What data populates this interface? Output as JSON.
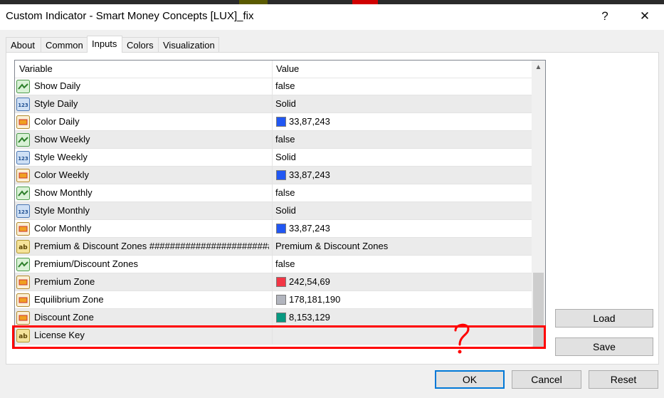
{
  "window": {
    "title": "Custom Indicator - Smart Money Concepts [LUX]_fix",
    "help_label": "?",
    "close_label": "✕"
  },
  "tabs": [
    {
      "label": "About"
    },
    {
      "label": "Common"
    },
    {
      "label": "Inputs",
      "active": true
    },
    {
      "label": "Colors"
    },
    {
      "label": "Visualization"
    }
  ],
  "grid": {
    "col_variable": "Variable",
    "col_value": "Value",
    "scroll_up_glyph": "▲",
    "rows": [
      {
        "icon": "bool-icon",
        "name": "Show Daily",
        "value": "false"
      },
      {
        "icon": "int-icon",
        "name": "Style Daily",
        "value": "Solid"
      },
      {
        "icon": "color-icon",
        "name": "Color Daily",
        "value": "33,87,243",
        "swatch": "#2157f3"
      },
      {
        "icon": "bool-icon",
        "name": "Show Weekly",
        "value": "false"
      },
      {
        "icon": "int-icon",
        "name": "Style Weekly",
        "value": "Solid"
      },
      {
        "icon": "color-icon",
        "name": "Color Weekly",
        "value": "33,87,243",
        "swatch": "#2157f3"
      },
      {
        "icon": "bool-icon",
        "name": "Show Monthly",
        "value": "false"
      },
      {
        "icon": "int-icon",
        "name": "Style Monthly",
        "value": "Solid"
      },
      {
        "icon": "color-icon",
        "name": "Color Monthly",
        "value": "33,87,243",
        "swatch": "#2157f3"
      },
      {
        "icon": "string-icon",
        "name": "Premium & Discount Zones #####################################",
        "value": "Premium & Discount Zones"
      },
      {
        "icon": "bool-icon",
        "name": "Premium/Discount Zones",
        "value": "false"
      },
      {
        "icon": "color-icon",
        "name": "Premium Zone",
        "value": "242,54,69",
        "swatch": "#f23645"
      },
      {
        "icon": "color-icon",
        "name": "Equilibrium Zone",
        "value": "178,181,190",
        "swatch": "#b2b5be"
      },
      {
        "icon": "color-icon",
        "name": "Discount Zone",
        "value": "8,153,129",
        "swatch": "#089981"
      },
      {
        "icon": "string-icon",
        "name": "License Key",
        "value": ""
      }
    ]
  },
  "buttons": {
    "load": "Load",
    "save": "Save",
    "ok": "OK",
    "cancel": "Cancel",
    "reset": "Reset"
  },
  "colors": {
    "annotation_red": "#ff0000",
    "focus_blue": "#0078d7"
  }
}
